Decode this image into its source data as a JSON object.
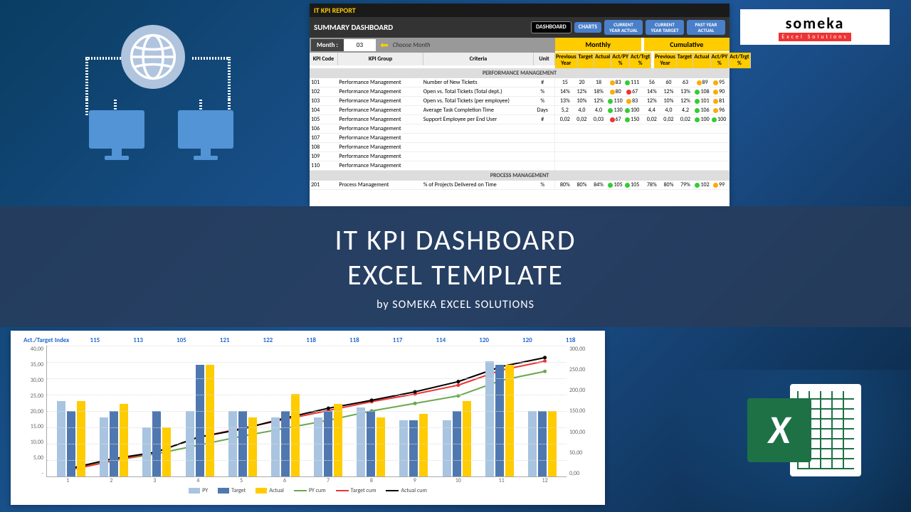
{
  "header": {
    "report_label": "IT KPI REPORT",
    "title": "SUMMARY DASHBOARD"
  },
  "nav": {
    "dashboard": "DASHBOARD",
    "charts": "CHARTS",
    "cy_actual": "CURRENT YEAR ACTUAL",
    "cy_target": "CURRENT YEAR TARGET",
    "py_actual": "PAST YEAR ACTUAL"
  },
  "logo": {
    "brand": "someka",
    "sub": "Excel Solutions"
  },
  "month": {
    "label": "Month :",
    "value": "03",
    "hint": "Choose Month"
  },
  "columns": {
    "kpi_code": "KPI Code",
    "kpi_group": "KPI Group",
    "criteria": "Criteria",
    "unit": "Unit",
    "monthly": "Monthly",
    "cumulative": "Cumulative",
    "prev_year": "Previous Year",
    "target": "Target",
    "actual": "Actual",
    "act_py": "Act/PY %",
    "act_trgt": "Act/Trgt %"
  },
  "groups": {
    "perf": "PERFORMANCE MANAGEMENT",
    "proc": "PROCESS MANAGEMENT"
  },
  "rows": [
    {
      "code": "101",
      "group": "Performance Management",
      "crit": "Number of New Tickets",
      "unit": "#",
      "m": {
        "py": "15",
        "tgt": "20",
        "act": "18",
        "apy": "83",
        "apyc": "do",
        "atg": "111",
        "atgc": "dg"
      },
      "c": {
        "py": "56",
        "tgt": "60",
        "act": "63",
        "apy": "89",
        "apyc": "do",
        "atg": "95",
        "atgc": "do"
      }
    },
    {
      "code": "102",
      "group": "Performance Management",
      "crit": "Open vs. Total Tickets (Total dept.)",
      "unit": "%",
      "m": {
        "py": "14%",
        "tgt": "12%",
        "act": "18%",
        "apy": "80",
        "apyc": "do",
        "atg": "67",
        "atgc": "dr"
      },
      "c": {
        "py": "14%",
        "tgt": "12%",
        "act": "13%",
        "apy": "108",
        "apyc": "dg",
        "atg": "90",
        "atgc": "do"
      }
    },
    {
      "code": "103",
      "group": "Performance Management",
      "crit": "Open vs. Total Tickets (per employee)",
      "unit": "%",
      "m": {
        "py": "13%",
        "tgt": "10%",
        "act": "12%",
        "apy": "110",
        "apyc": "dg",
        "atg": "83",
        "atgc": "do"
      },
      "c": {
        "py": "12%",
        "tgt": "10%",
        "act": "12%",
        "apy": "101",
        "apyc": "dg",
        "atg": "81",
        "atgc": "do"
      }
    },
    {
      "code": "104",
      "group": "Performance Management",
      "crit": "Average Task Completion Time",
      "unit": "Days",
      "m": {
        "py": "5,2",
        "tgt": "4,0",
        "act": "4,0",
        "apy": "130",
        "apyc": "dg",
        "atg": "100",
        "atgc": "dg"
      },
      "c": {
        "py": "4,4",
        "tgt": "4,0",
        "act": "4,2",
        "apy": "106",
        "apyc": "dg",
        "atg": "96",
        "atgc": "do"
      }
    },
    {
      "code": "105",
      "group": "Performance Management",
      "crit": "Support Employee per End User",
      "unit": "#",
      "m": {
        "py": "0,02",
        "tgt": "0,02",
        "act": "0,03",
        "apy": "67",
        "apyc": "dr",
        "atg": "150",
        "atgc": "dg"
      },
      "c": {
        "py": "0,02",
        "tgt": "0,02",
        "act": "0,02",
        "apy": "100",
        "apyc": "dg",
        "atg": "100",
        "atgc": "dg"
      }
    },
    {
      "code": "106",
      "group": "Performance Management",
      "crit": "",
      "unit": "",
      "m": null,
      "c": null
    },
    {
      "code": "107",
      "group": "Performance Management",
      "crit": "",
      "unit": "",
      "m": null,
      "c": null
    },
    {
      "code": "108",
      "group": "Performance Management",
      "crit": "",
      "unit": "",
      "m": null,
      "c": null
    },
    {
      "code": "109",
      "group": "Performance Management",
      "crit": "",
      "unit": "",
      "m": null,
      "c": null
    },
    {
      "code": "110",
      "group": "Performance Management",
      "crit": "",
      "unit": "",
      "m": null,
      "c": null
    }
  ],
  "proc_row": {
    "code": "201",
    "group": "Process Management",
    "crit": "% of Projects Delivered on Time",
    "unit": "%",
    "m": {
      "py": "80%",
      "tgt": "80%",
      "act": "84%",
      "apy": "105",
      "apyc": "dg",
      "atg": "105",
      "atgc": "dg"
    },
    "c": {
      "py": "78%",
      "tgt": "80%",
      "act": "79%",
      "apy": "102",
      "apyc": "dg",
      "atg": "99",
      "atgc": "do"
    }
  },
  "overlay": {
    "l1": "IT KPI DASHBOARD",
    "l2": "EXCEL TEMPLATE",
    "l3": "by SOMEKA EXCEL SOLUTIONS"
  },
  "chart_data": {
    "type": "bar+line",
    "index_label": "Act./Target Index",
    "index": [
      115,
      113,
      105,
      121,
      122,
      118,
      118,
      117,
      114,
      120,
      120,
      118
    ],
    "categories": [
      1,
      2,
      3,
      4,
      5,
      6,
      7,
      8,
      9,
      10,
      11,
      12
    ],
    "y1": {
      "ticks": [
        "40,00",
        "35,00",
        "30,00",
        "25,00",
        "20,00",
        "15,00",
        "10,00",
        "5,00",
        "-"
      ],
      "max": 40
    },
    "y2": {
      "ticks": [
        "300,00",
        "250,00",
        "200,00",
        "150,00",
        "100,00",
        "50,00",
        "0,00"
      ],
      "max": 300
    },
    "series": [
      {
        "name": "PY",
        "type": "bar",
        "color": "#a8c4e0",
        "values": [
          23,
          18,
          15,
          20,
          20,
          18,
          18,
          21,
          17,
          17,
          35,
          20
        ]
      },
      {
        "name": "Target",
        "type": "bar",
        "color": "#5078b0",
        "values": [
          20,
          20,
          20,
          34,
          20,
          20,
          20,
          20,
          17,
          20,
          34,
          20
        ]
      },
      {
        "name": "Actual",
        "type": "bar",
        "color": "#ffcc00",
        "values": [
          23,
          22,
          15,
          34,
          18,
          25,
          22,
          18,
          19,
          23,
          34,
          20
        ]
      },
      {
        "name": "PY cum",
        "type": "line",
        "color": "#6aa84f",
        "values": [
          23,
          41,
          56,
          76,
          96,
          114,
          132,
          153,
          170,
          187,
          222,
          242
        ],
        "axis": "y2"
      },
      {
        "name": "Target cum",
        "type": "line",
        "color": "#e33",
        "values": [
          20,
          40,
          60,
          94,
          114,
          134,
          154,
          174,
          191,
          211,
          245,
          265
        ],
        "axis": "y2"
      },
      {
        "name": "Actual cum",
        "type": "line",
        "color": "#000",
        "values": [
          23,
          45,
          60,
          94,
          112,
          137,
          159,
          177,
          196,
          219,
          253,
          273
        ],
        "axis": "y2"
      }
    ]
  },
  "legend": {
    "py": "PY",
    "target": "Target",
    "actual": "Actual",
    "pycum": "PY cum",
    "tgtcum": "Target cum",
    "actcum": "Actual cum"
  }
}
